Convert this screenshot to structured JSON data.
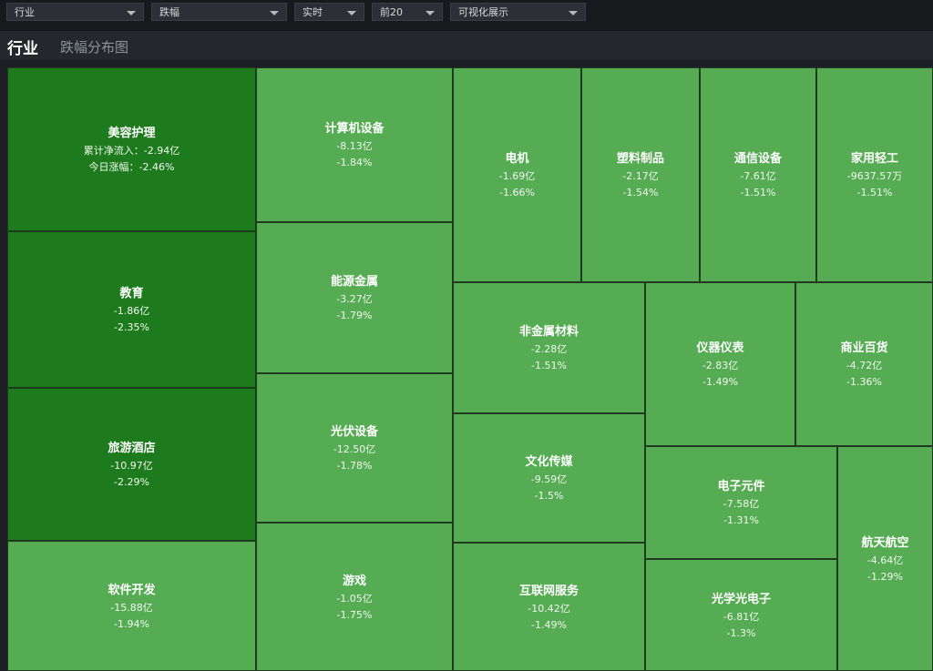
{
  "toolbar": {
    "dropdowns": [
      {
        "id": "category",
        "value": "行业"
      },
      {
        "id": "metric",
        "value": "跌幅"
      },
      {
        "id": "period",
        "value": "实时"
      },
      {
        "id": "topn",
        "value": "前20"
      },
      {
        "id": "view",
        "value": "可视化展示"
      }
    ]
  },
  "header": {
    "title": "行业",
    "subtitle": "跌幅分布图"
  },
  "colors": {
    "strong": "#1e7b1d",
    "normal": "#55ac52",
    "background": "#1c1f24"
  },
  "tiles": [
    {
      "name": "美容护理",
      "flow": "累计净流入：-2.94亿",
      "change": "今日涨幅：-2.46%"
    },
    {
      "name": "教育",
      "flow": "-1.86亿",
      "change": "-2.35%"
    },
    {
      "name": "旅游酒店",
      "flow": "-10.97亿",
      "change": "-2.29%"
    },
    {
      "name": "软件开发",
      "flow": "-15.88亿",
      "change": "-1.94%"
    },
    {
      "name": "计算机设备",
      "flow": "-8.13亿",
      "change": "-1.84%"
    },
    {
      "name": "能源金属",
      "flow": "-3.27亿",
      "change": "-1.79%"
    },
    {
      "name": "光伏设备",
      "flow": "-12.50亿",
      "change": "-1.78%"
    },
    {
      "name": "游戏",
      "flow": "-1.05亿",
      "change": "-1.75%"
    },
    {
      "name": "电机",
      "flow": "-1.69亿",
      "change": "-1.66%"
    },
    {
      "name": "塑料制品",
      "flow": "-2.17亿",
      "change": "-1.54%"
    },
    {
      "name": "通信设备",
      "flow": "-7.61亿",
      "change": "-1.51%"
    },
    {
      "name": "家用轻工",
      "flow": "-9637.57万",
      "change": "-1.51%"
    },
    {
      "name": "非金属材料",
      "flow": "-2.28亿",
      "change": "-1.51%"
    },
    {
      "name": "仪器仪表",
      "flow": "-2.83亿",
      "change": "-1.49%"
    },
    {
      "name": "商业百货",
      "flow": "-4.72亿",
      "change": "-1.36%"
    },
    {
      "name": "文化传媒",
      "flow": "-9.59亿",
      "change": "-1.5%"
    },
    {
      "name": "电子元件",
      "flow": "-7.58亿",
      "change": "-1.31%"
    },
    {
      "name": "航天航空",
      "flow": "-4.64亿",
      "change": "-1.29%"
    },
    {
      "name": "互联网服务",
      "flow": "-10.42亿",
      "change": "-1.49%"
    },
    {
      "name": "光学光电子",
      "flow": "-6.81亿",
      "change": "-1.3%"
    }
  ]
}
